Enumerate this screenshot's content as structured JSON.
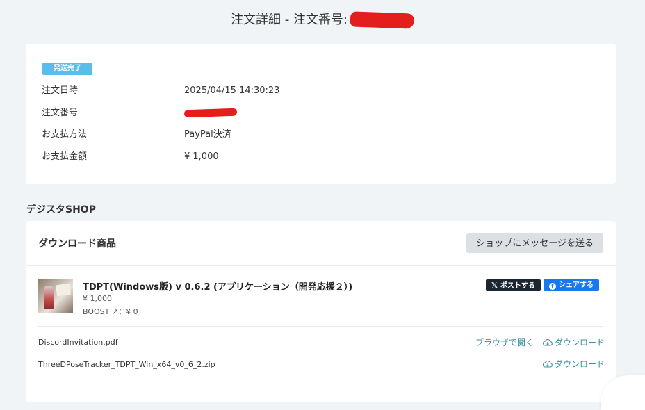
{
  "header": {
    "title_prefix": "注文詳細 - 注文番号:"
  },
  "order": {
    "status_badge": "発送完了",
    "rows": [
      {
        "label": "注文日時",
        "value": "2025/04/15 14:30:23"
      },
      {
        "label": "注文番号",
        "value": ""
      },
      {
        "label": "お支払方法",
        "value": "PayPal決済"
      },
      {
        "label": "お支払金額",
        "value": "¥ 1,000"
      }
    ]
  },
  "shop": {
    "name": "デジスタSHOP"
  },
  "downloads": {
    "heading": "ダウンロード商品",
    "message_button": "ショップにメッセージを送る",
    "product": {
      "title": "TDPT(Windows版) v 0.6.2 (アプリケーション（開発応援２）)",
      "price": "¥ 1,000",
      "boost": "BOOST ↗：¥ 0"
    },
    "share_x_label": "ポストする",
    "share_fb_label": "シェアする",
    "files": [
      {
        "name": "DiscordInvitation.pdf",
        "open_label": "ブラウザで開く",
        "download_label": "ダウンロード"
      },
      {
        "name": "ThreeDPoseTracker_TDPT_Win_x64_v0_6_2.zip",
        "download_label": "ダウンロード"
      }
    ]
  },
  "colors": {
    "background": "#f1f4f7",
    "badge": "#5bbde9",
    "link": "#3a8ea0",
    "facebook": "#1877f2",
    "x_button": "#1c2633",
    "redaction": "#e41d1d"
  }
}
